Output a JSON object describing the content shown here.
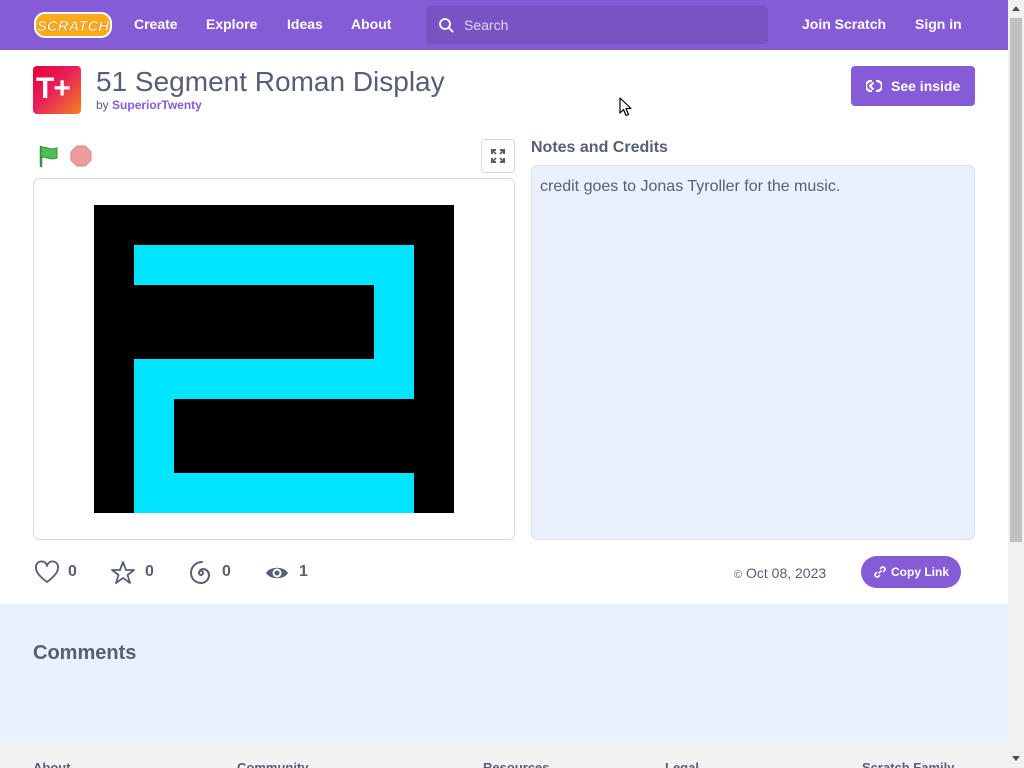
{
  "nav": {
    "logo_text": "SCRATCH",
    "links": [
      "Create",
      "Explore",
      "Ideas",
      "About"
    ],
    "search_placeholder": "Search",
    "join_label": "Join Scratch",
    "signin_label": "Sign in"
  },
  "project": {
    "avatar_text": "T+",
    "title": "51 Segment Roman Display",
    "by_label": "by",
    "author": "SuperiorTwenty",
    "see_inside_label": "See inside"
  },
  "notes": {
    "heading": "Notes and Credits",
    "text": "credit goes to Jonas Tyroller for the music."
  },
  "stats": {
    "loves": "0",
    "favorites": "0",
    "remixes": "0",
    "views": "1",
    "date": "Oct 08, 2023",
    "copy_link_label": "Copy Link"
  },
  "comments": {
    "heading": "Comments"
  },
  "footer": {
    "headings": [
      "About",
      "Community",
      "Resources",
      "Legal",
      "Scratch Family"
    ]
  },
  "colors": {
    "brand": "#855cd6",
    "segment": "#00e5ff",
    "notes_bg": "#e9f1fc"
  },
  "icons": [
    "search-icon",
    "remix-icon",
    "green-flag-icon",
    "stop-icon",
    "fullscreen-icon",
    "heart-icon",
    "star-icon",
    "remix-swirl-icon",
    "eye-icon",
    "copyright-icon",
    "link-icon"
  ]
}
